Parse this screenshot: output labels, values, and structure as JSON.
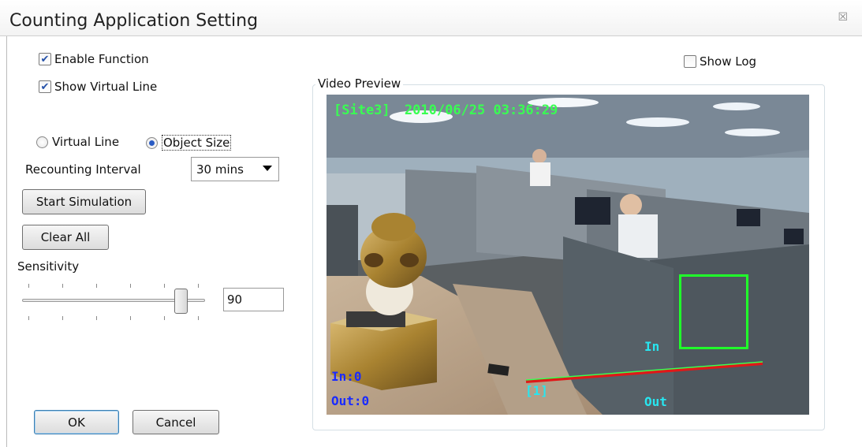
{
  "window": {
    "title": "Counting Application Setting",
    "close_glyph": "☒"
  },
  "options": {
    "enable_function": {
      "label": "Enable Function",
      "checked": true
    },
    "show_virtual_line": {
      "label": "Show Virtual Line",
      "checked": true
    },
    "show_log": {
      "label": "Show Log",
      "checked": false
    }
  },
  "mode": {
    "virtual_line_label": "Virtual Line",
    "object_size_label": "Object Size",
    "selected": "Object Size"
  },
  "recounting": {
    "label": "Recounting Interval",
    "value": "30 mins"
  },
  "buttons": {
    "start_simulation": "Start Simulation",
    "clear_all": "Clear All",
    "ok": "OK",
    "cancel": "Cancel"
  },
  "sensitivity": {
    "label": "Sensitivity",
    "value": "90",
    "level_fraction": 0.9
  },
  "preview": {
    "group_label": "Video Preview",
    "overlay": {
      "site": "[Site3]",
      "timestamp": "2010/06/25 03:36:29",
      "in_count": "In:0",
      "out_count": "Out:0",
      "in_label": "In",
      "out_label": "Out",
      "line_id": "[1]"
    }
  },
  "colors": {
    "overlay_green": "#39ff52",
    "overlay_blue": "#1a2bff",
    "overlay_cyan": "#27e6f0",
    "line_red": "#e01818",
    "accent_blue": "#2a5cc4"
  }
}
